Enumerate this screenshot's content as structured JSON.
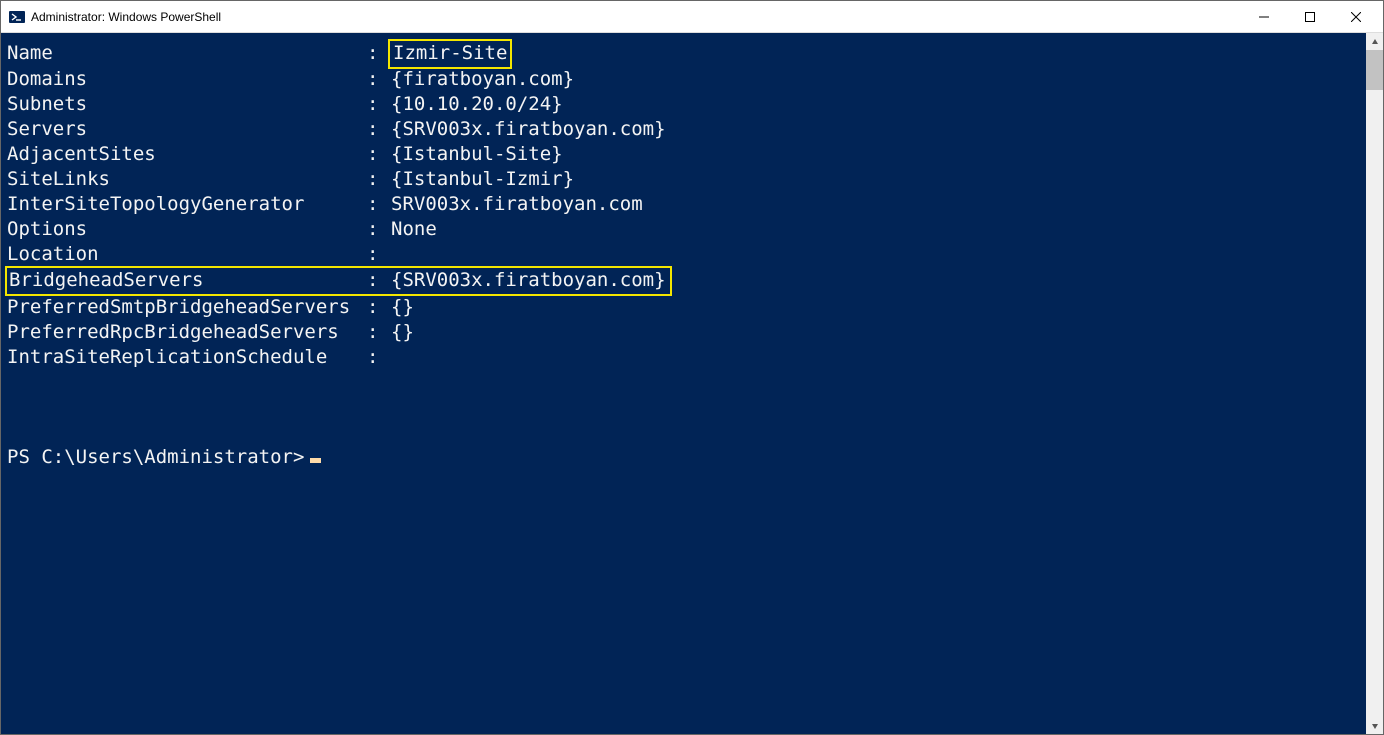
{
  "window": {
    "title": "Administrator: Windows PowerShell"
  },
  "output": {
    "rows": [
      {
        "label": "Name",
        "value": "Izmir-Site",
        "hv": true
      },
      {
        "label": "Domains",
        "value": "{firatboyan.com}"
      },
      {
        "label": "Subnets",
        "value": "{10.10.20.0/24}"
      },
      {
        "label": "Servers",
        "value": "{SRV003x.firatboyan.com}"
      },
      {
        "label": "AdjacentSites",
        "value": "{Istanbul-Site}"
      },
      {
        "label": "SiteLinks",
        "value": "{Istanbul-Izmir}"
      },
      {
        "label": "InterSiteTopologyGenerator",
        "value": "SRV003x.firatboyan.com"
      },
      {
        "label": "Options",
        "value": "None"
      },
      {
        "label": "Location",
        "value": ""
      },
      {
        "label": "BridgeheadServers",
        "value": "{SRV003x.firatboyan.com}",
        "hr": true
      },
      {
        "label": "PreferredSmtpBridgeheadServers",
        "value": "{}"
      },
      {
        "label": "PreferredRpcBridgeheadServers",
        "value": "{}"
      },
      {
        "label": "IntraSiteReplicationSchedule",
        "value": ""
      }
    ]
  },
  "prompt": "PS C:\\Users\\Administrator>"
}
